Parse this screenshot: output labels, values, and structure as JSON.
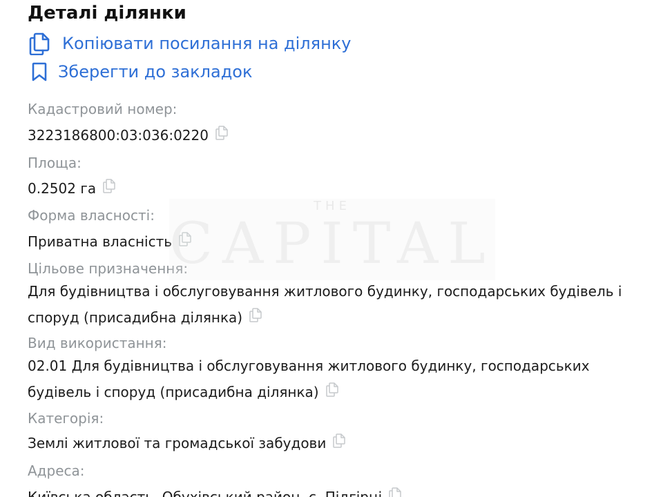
{
  "title": "Деталі ділянки",
  "actions": {
    "copy_link": "Копіювати посилання на ділянку",
    "bookmark": "Зберегти до закладок"
  },
  "fields": {
    "cadastral": {
      "label": "Кадастровий номер:",
      "value": "3223186800:03:036:0220"
    },
    "area": {
      "label": "Площа:",
      "value": "0.2502 га"
    },
    "ownership": {
      "label": "Форма власності:",
      "value": "Приватна власність"
    },
    "purpose": {
      "label": "Цільове призначення:",
      "value": "Для будівництва і обслуговування житлового будинку, господарських будівель і споруд (присадибна ділянка)"
    },
    "usage": {
      "label": "Вид використання:",
      "value": "02.01 Для будівництва і обслуговування житлового будинку, господарських будівель і споруд (присадибна ділянка)"
    },
    "category": {
      "label": "Категорія:",
      "value": "Землі житлової та громадської забудови"
    },
    "address": {
      "label": "Адреса:",
      "value": "Київська область, Обухівський район, с. Підгірці"
    }
  },
  "watermark": {
    "top": "THE",
    "main": "CAPITAL"
  },
  "colors": {
    "accent": "#2e6fd6",
    "label": "#8f9498",
    "text": "#1c1c1c"
  },
  "icons": {
    "copy_link": "copy-link-icon",
    "bookmark": "bookmark-icon",
    "copy_value": "copy-icon"
  }
}
